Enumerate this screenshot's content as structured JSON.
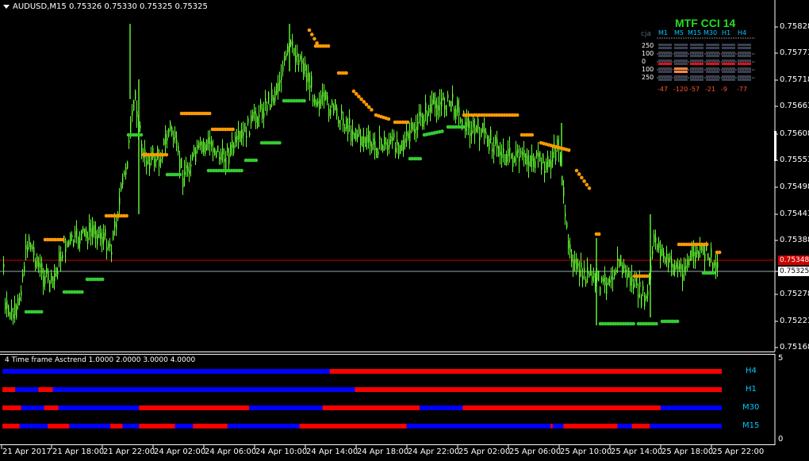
{
  "chart": {
    "symbol_line": "AUDUSD,M15  0.75326 0.75330 0.75325 0.75325",
    "price_labels": [
      "0.75828",
      "0.75773",
      "0.75718",
      "0.75663",
      "0.75608",
      "0.75553",
      "0.75498",
      "0.75443",
      "0.75388",
      "0.75325",
      "0.75278",
      "0.75223",
      "0.75168"
    ],
    "red_line_price": "0.75348",
    "current_price": "0.75325",
    "time_labels": [
      "21 Apr 2017",
      "21 Apr 18:00",
      "21 Apr 22:00",
      "24 Apr 02:00",
      "24 Apr 06:00",
      "24 Apr 10:00",
      "24 Apr 14:00",
      "24 Apr 18:00",
      "24 Apr 22:00",
      "25 Apr 02:00",
      "25 Apr 06:00",
      "25 Apr 10:00",
      "25 Apr 14:00",
      "25 Apr 18:00",
      "25 Apr 22:00"
    ],
    "colors": {
      "candle": "#66ff33",
      "dot_orange": "#ff9900",
      "dot_green": "#33cc33",
      "red_line": "#cc0000",
      "grey_line": "#9aa8b0"
    }
  },
  "mtf": {
    "title": "MTF CCI  14",
    "corner": "cja",
    "timeframes": [
      "M1",
      "M5",
      "M15",
      "M30",
      "H1",
      "H4"
    ],
    "levels": [
      "250",
      "100",
      "0",
      "100",
      "250"
    ],
    "values": [
      "-47",
      "-120",
      "-57",
      "-21",
      "-9",
      "-77"
    ]
  },
  "indicator": {
    "label": "4 Time frame Asctrend 1.0000 2.0000 3.0000 4.0000",
    "scale_top": "5",
    "scale_bottom": "0",
    "rows": [
      {
        "name": "H4",
        "segments": [
          [
            "#0000ff",
            0.0,
            0.455
          ],
          [
            "#ff0000",
            0.455,
            1.0
          ]
        ]
      },
      {
        "name": "H1",
        "segments": [
          [
            "#ff0000",
            0.0,
            0.018
          ],
          [
            "#0000ff",
            0.018,
            0.05
          ],
          [
            "#ff0000",
            0.05,
            0.07
          ],
          [
            "#0000ff",
            0.07,
            0.49
          ],
          [
            "#ff0000",
            0.49,
            1.0
          ]
        ]
      },
      {
        "name": "M30",
        "segments": [
          [
            "#ff0000",
            0.0,
            0.026
          ],
          [
            "#0000ff",
            0.026,
            0.058
          ],
          [
            "#ff0000",
            0.058,
            0.078
          ],
          [
            "#0000ff",
            0.078,
            0.19
          ],
          [
            "#ff0000",
            0.19,
            0.343
          ],
          [
            "#0000ff",
            0.343,
            0.445
          ],
          [
            "#ff0000",
            0.445,
            0.58
          ],
          [
            "#0000ff",
            0.58,
            0.64
          ],
          [
            "#ff0000",
            0.64,
            0.915
          ],
          [
            "#0000ff",
            0.915,
            1.0
          ]
        ]
      },
      {
        "name": "M15",
        "segments": [
          [
            "#ff0000",
            0.0,
            0.024
          ],
          [
            "#0000ff",
            0.024,
            0.063
          ],
          [
            "#ff0000",
            0.063,
            0.093
          ],
          [
            "#0000ff",
            0.093,
            0.15
          ],
          [
            "#ff0000",
            0.15,
            0.167
          ],
          [
            "#0000ff",
            0.167,
            0.19
          ],
          [
            "#ff0000",
            0.19,
            0.24
          ],
          [
            "#0000ff",
            0.24,
            0.265
          ],
          [
            "#ff0000",
            0.265,
            0.313
          ],
          [
            "#0000ff",
            0.313,
            0.413
          ],
          [
            "#ff0000",
            0.413,
            0.562
          ],
          [
            "#0000ff",
            0.562,
            0.762
          ],
          [
            "#ff0000",
            0.762,
            0.765
          ],
          [
            "#0000ff",
            0.765,
            0.78
          ],
          [
            "#ff0000",
            0.78,
            0.855
          ],
          [
            "#0000ff",
            0.855,
            0.875
          ],
          [
            "#ff0000",
            0.875,
            0.9
          ],
          [
            "#0000ff",
            0.9,
            1.0
          ]
        ]
      }
    ]
  }
}
